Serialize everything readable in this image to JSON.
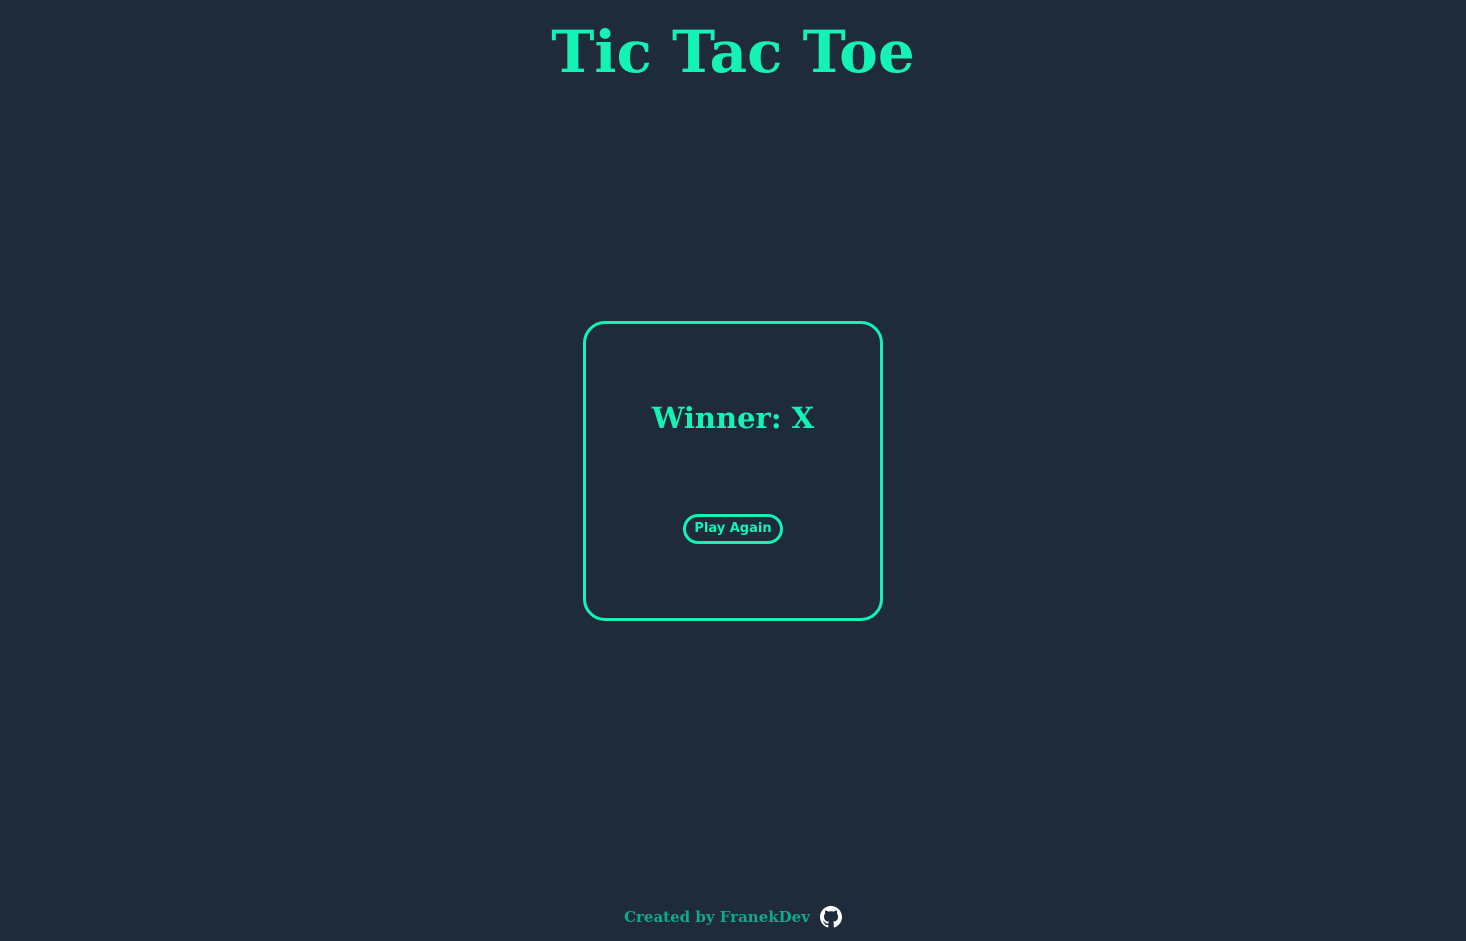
{
  "header": {
    "title": "Tic Tac Toe"
  },
  "game": {
    "result_text": "Winner: X",
    "play_again_label": "Play Again"
  },
  "footer": {
    "credit_text": "Created by FranekDev",
    "icon": "github-icon"
  },
  "colors": {
    "background": "#1f2b3b",
    "accent": "#14f3b5",
    "footer_text": "#10a98a",
    "icon": "#ffffff"
  }
}
